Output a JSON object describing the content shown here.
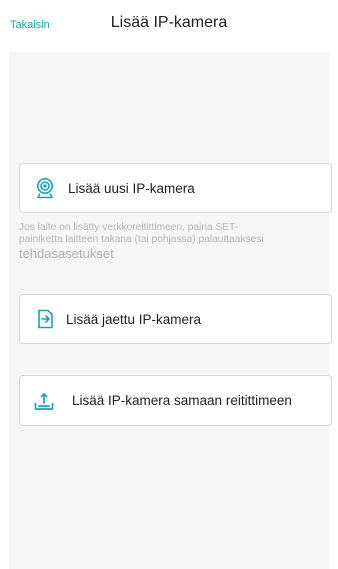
{
  "header": {
    "back_label": "Takaisin",
    "title": "Lisää IP-kamera"
  },
  "options": {
    "add_new": {
      "label": "Lisää uusi IP-kamera",
      "icon": "webcam-icon"
    },
    "reset_hint": {
      "line1": "Jos laite on lisätty verkkoreitittimeen, paina SET-",
      "line2": "painiketta laitteen takana (tai pohjassa) palauttaaksesi",
      "line3": "tehdasasetukset"
    },
    "add_shared": {
      "label": "Lisää jaettu IP-kamera",
      "icon": "share-in-icon"
    },
    "add_same_router": {
      "label": "Lisää IP-kamera samaan reitittimeen",
      "icon": "router-icon"
    }
  },
  "colors": {
    "accent": "#1ba3b6",
    "background": "#f6f6f6",
    "card_border": "#d6d6d6",
    "hint_text": "#b5b5b5"
  }
}
